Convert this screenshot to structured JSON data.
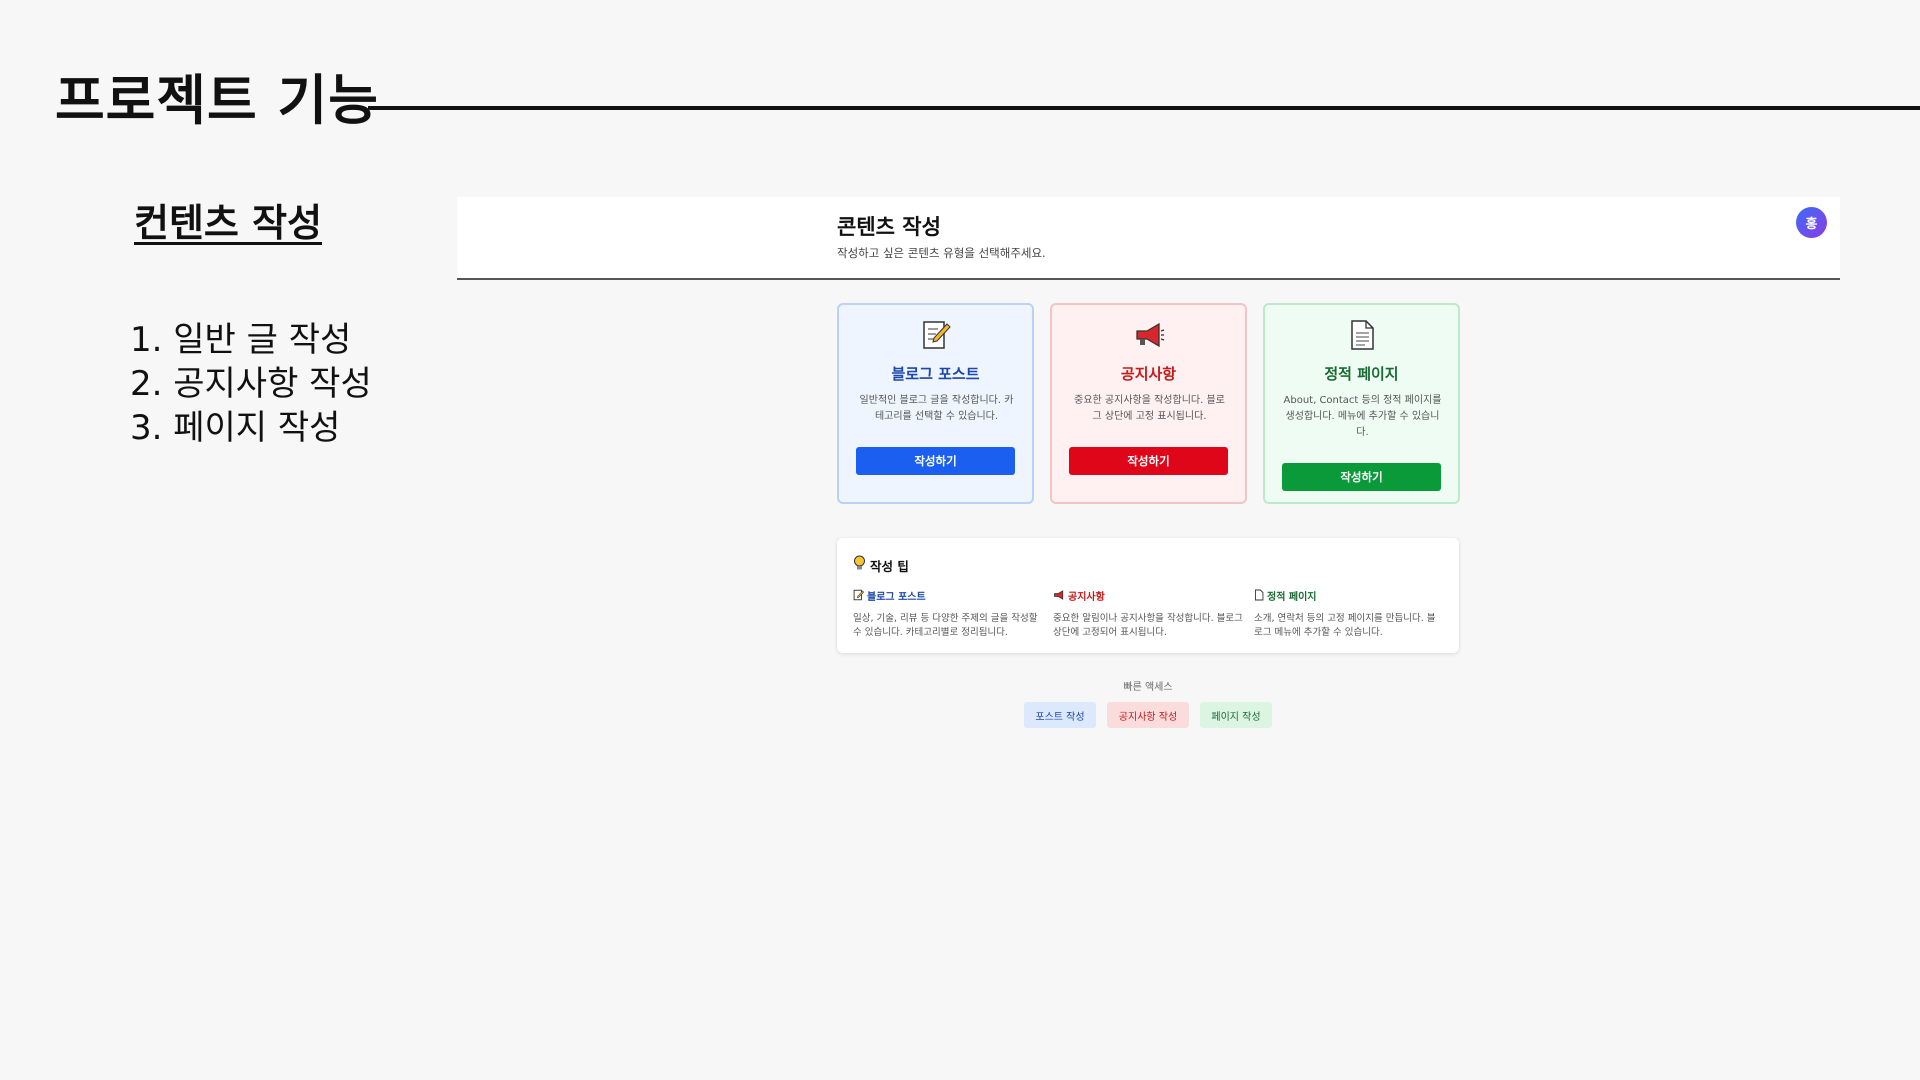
{
  "slide": {
    "title": "프로젝트 기능",
    "section_title": "컨텐츠 작성",
    "features": [
      "1. 일반 글 작성",
      "2. 공지사항 작성",
      "3. 페이지 작성"
    ]
  },
  "screen": {
    "header": {
      "title": "콘텐츠 작성",
      "subtitle": "작성하고 싶은 콘텐츠 유형을 선택해주세요.",
      "avatar_initial": "홍"
    },
    "cards": [
      {
        "icon": "memo-icon",
        "title": "블로그 포스트",
        "description": "일반적인 블로그 글을 작성합니다. 카테고리를 선택할 수 있습니다.",
        "button": "작성하기",
        "color": "#1a5ff0"
      },
      {
        "icon": "megaphone-icon",
        "title": "공지사항",
        "description": "중요한 공지사항을 작성합니다. 블로그 상단에 고정 표시됩니다.",
        "button": "작성하기",
        "color": "#e0061a"
      },
      {
        "icon": "page-icon",
        "title": "정적 페이지",
        "description": "About, Contact 등의 정적 페이지를 생성합니다. 메뉴에 추가할 수 있습니다.",
        "button": "작성하기",
        "color": "#0b9a3a"
      }
    ],
    "tips": {
      "icon": "lightbulb-icon",
      "title": "작성 팁",
      "items": [
        {
          "icon": "memo-icon",
          "label": "블로그 포스트",
          "text": "일상, 기술, 리뷰 등 다양한 주제의 글을 작성할 수 있습니다. 카테고리별로 정리됩니다."
        },
        {
          "icon": "megaphone-icon",
          "label": "공지사항",
          "text": "중요한 알림이나 공지사항을 작성합니다. 블로그 상단에 고정되어 표시됩니다."
        },
        {
          "icon": "page-icon",
          "label": "정적 페이지",
          "text": "소개, 연락처 등의 고정 페이지를 만듭니다. 블로그 메뉴에 추가할 수 있습니다."
        }
      ]
    },
    "quick_access": {
      "label": "빠른 액세스",
      "links": [
        "포스트 작성",
        "공지사항 작성",
        "페이지 작성"
      ]
    }
  }
}
